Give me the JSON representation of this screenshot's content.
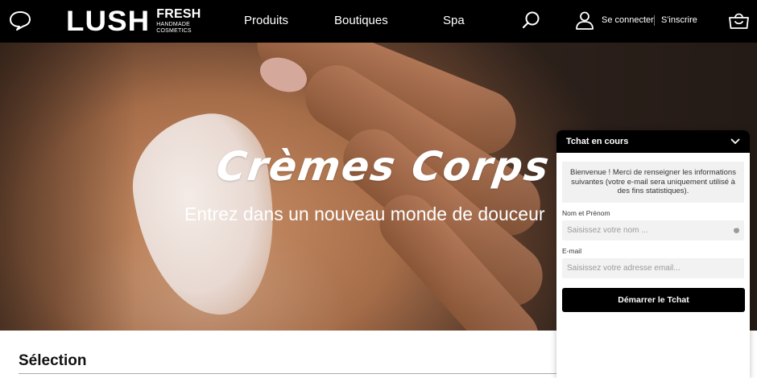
{
  "header": {
    "logo_main": "LUSH",
    "logo_fresh": "FRESH",
    "logo_line1": "HANDMADE",
    "logo_line2": "COSMETICS",
    "nav": [
      "Produits",
      "Boutiques",
      "Spa"
    ],
    "login": "Se connecter",
    "signup": "S'inscrire"
  },
  "hero": {
    "title": "Crèmes Corps",
    "subtitle": "Entrez dans un nouveau monde de douceur"
  },
  "section": {
    "title": "Sélection"
  },
  "chat": {
    "header": "Tchat en cours",
    "welcome": "Bienvenue ! Merci de renseigner les informations suivantes (votre e-mail sera uniquement utilisé à des fins statistiques).",
    "name_label": "Nom et Prénom",
    "name_placeholder": "Saisissez votre nom ...",
    "email_label": "E-mail",
    "email_placeholder": "Saisissez votre adresse email...",
    "start_button": "Démarrer le Tchat"
  }
}
